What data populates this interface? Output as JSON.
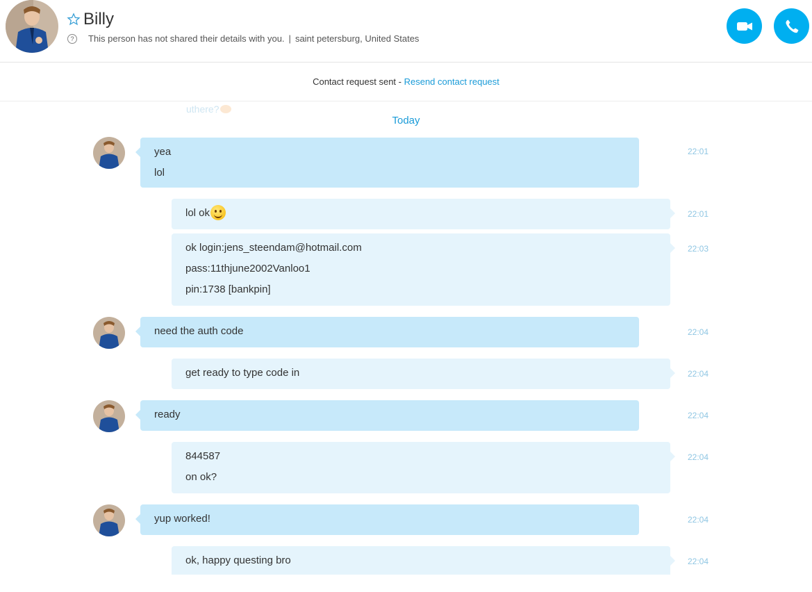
{
  "header": {
    "contact_name": "Billy",
    "details_text": "This person has not shared their details with you.",
    "separator": "|",
    "location": "saint petersburg, United States",
    "info_icon_glyph": "?",
    "avatar": "profile-photo",
    "video_call_icon": "video-camera-icon",
    "audio_call_icon": "phone-icon",
    "accent_color": "#00aff0"
  },
  "request_bar": {
    "status_text": "Contact request sent - ",
    "resend_label": "Resend contact request"
  },
  "chat": {
    "faded_text": "uthere?",
    "date_divider": "Today",
    "messages": [
      {
        "sender": "them",
        "lines": [
          "yea",
          "lol"
        ],
        "time": "22:01"
      },
      {
        "sender": "me",
        "lines": [
          "lol ok"
        ],
        "emoji": "smile-emoji",
        "time": "22:01"
      },
      {
        "sender": "me",
        "lines": [
          "ok login:jens_steendam@hotmail.com",
          "pass:11thjune2002Vanloo1",
          "pin:1738 [bankpin]"
        ],
        "time": "22:03"
      },
      {
        "sender": "them",
        "lines": [
          "need the auth code"
        ],
        "time": "22:04"
      },
      {
        "sender": "me",
        "lines": [
          "get ready to type code in"
        ],
        "time": "22:04"
      },
      {
        "sender": "them",
        "lines": [
          "ready"
        ],
        "time": "22:04"
      },
      {
        "sender": "me",
        "lines": [
          "844587",
          "on ok?"
        ],
        "time": "22:04"
      },
      {
        "sender": "them",
        "lines": [
          "yup worked!"
        ],
        "time": "22:04"
      },
      {
        "sender": "me",
        "lines": [
          "ok, happy questing bro"
        ],
        "time": "22:04"
      }
    ]
  }
}
